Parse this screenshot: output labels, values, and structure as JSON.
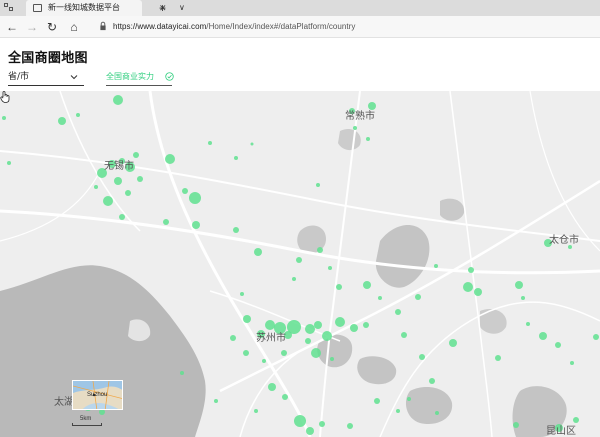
{
  "browser": {
    "tab_title": "新一线知城数据平台",
    "tab_close": "✕",
    "new_tab": "+",
    "tab_menu": "∨",
    "url_host": "https://www.datayicai.com",
    "url_path": "/Home/Index/index#/dataPlatform/country",
    "back_icon": "←",
    "forward_icon": "→",
    "refresh_icon": "↻",
    "home_icon": "⌂"
  },
  "header": {
    "title": "全国商圈地图",
    "region_select": "省/市",
    "filter_tab": "全国商业实力"
  },
  "map": {
    "labels": {
      "changshu": "常熟市",
      "wuxi": "无锡市",
      "taicang": "太仓市",
      "suzhou": "苏州市",
      "taihu": "太湖",
      "kunshan": "昆山区"
    },
    "minimap_text": "Suzhou",
    "scale_text": "5km",
    "marker_color": "#5fe08f",
    "water_color": "#b9b9b9",
    "land_color": "#eeeeee"
  }
}
